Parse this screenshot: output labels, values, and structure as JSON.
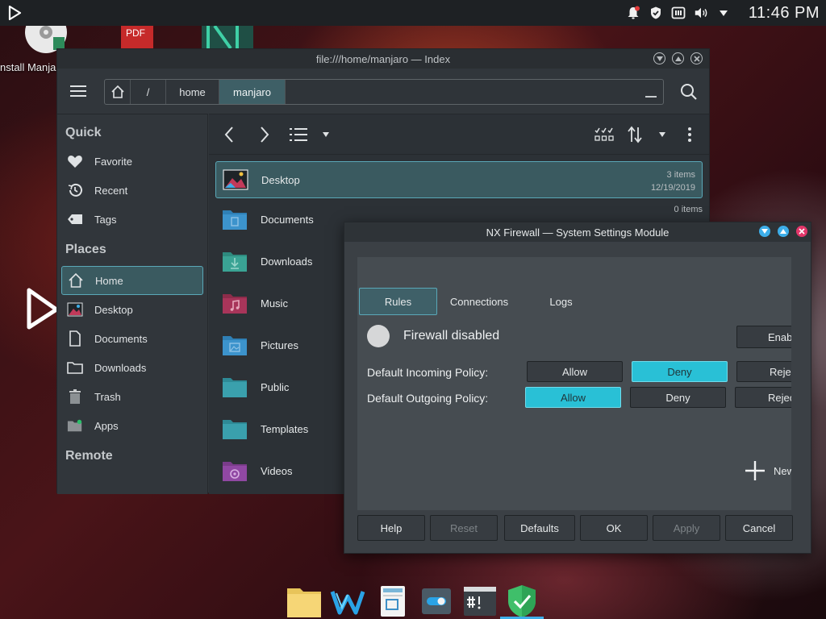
{
  "top_panel": {
    "clock": "11:46 PM",
    "icons": [
      "play-launcher-icon",
      "notification-bell-icon",
      "shield-icon",
      "media-icon",
      "volume-icon",
      "tray-arrow-icon"
    ]
  },
  "desktop": {
    "install_label": "Install Manjaro Linux",
    "pdf_badge": "PDF"
  },
  "dolphin": {
    "title": "file:///home/manjaro — Index",
    "breadcrumb": {
      "root": "/",
      "parts": [
        "home",
        "manjaro"
      ]
    },
    "sidebar": {
      "quick_heading": "Quick",
      "quick": [
        {
          "label": "Favorite",
          "icon": "heart-icon"
        },
        {
          "label": "Recent",
          "icon": "history-icon"
        },
        {
          "label": "Tags",
          "icon": "tag-icon"
        }
      ],
      "places_heading": "Places",
      "places": [
        {
          "label": "Home",
          "icon": "home-icon"
        },
        {
          "label": "Desktop",
          "icon": "desktop-folder-icon"
        },
        {
          "label": "Documents",
          "icon": "document-icon"
        },
        {
          "label": "Downloads",
          "icon": "folder-outline-icon"
        },
        {
          "label": "Trash",
          "icon": "trash-icon"
        },
        {
          "label": "Apps",
          "icon": "apps-icon"
        }
      ],
      "remote_heading": "Remote"
    },
    "files": [
      {
        "name": "Desktop",
        "items": "3 items",
        "date": "12/19/2019"
      },
      {
        "name": "Documents",
        "items": "0 items",
        "date": ""
      },
      {
        "name": "Downloads"
      },
      {
        "name": "Music"
      },
      {
        "name": "Pictures"
      },
      {
        "name": "Public"
      },
      {
        "name": "Templates"
      },
      {
        "name": "Videos"
      }
    ]
  },
  "firewall": {
    "title": "NX Firewall — System Settings Module",
    "tabs": [
      "Rules",
      "Connections",
      "Logs"
    ],
    "status": "Firewall disabled",
    "enable_label": "Enab",
    "incoming": {
      "label": "Default Incoming Policy:",
      "options": [
        "Allow",
        "Deny",
        "Rejec"
      ],
      "selected": "Deny"
    },
    "outgoing": {
      "label": "Default Outgoing Policy:",
      "options": [
        "Allow",
        "Deny",
        "Rejec"
      ],
      "selected": "Allow"
    },
    "new_rule_label": "New",
    "footer": [
      "Help",
      "Reset",
      "Defaults",
      "OK",
      "Apply",
      "Cancel"
    ]
  },
  "colors": {
    "accent": "#29c0d6",
    "selection": "#3a5a60",
    "window_bg": "#31363b"
  }
}
